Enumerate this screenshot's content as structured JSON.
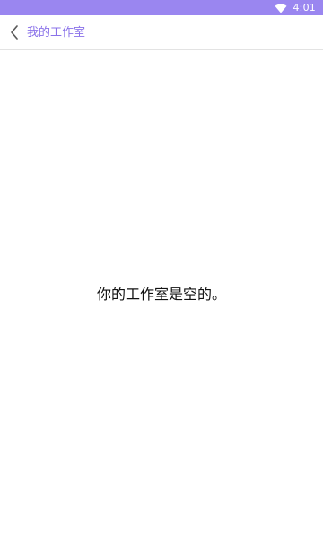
{
  "status_bar": {
    "time": "4:01",
    "background_color": "#9a86f0",
    "icons": [
      "wifi-icon"
    ]
  },
  "app_bar": {
    "title": "我的工作室",
    "title_color": "#8a72e9",
    "back_icon": "chevron-left-icon"
  },
  "content": {
    "empty_message": "你的工作室是空的。"
  }
}
